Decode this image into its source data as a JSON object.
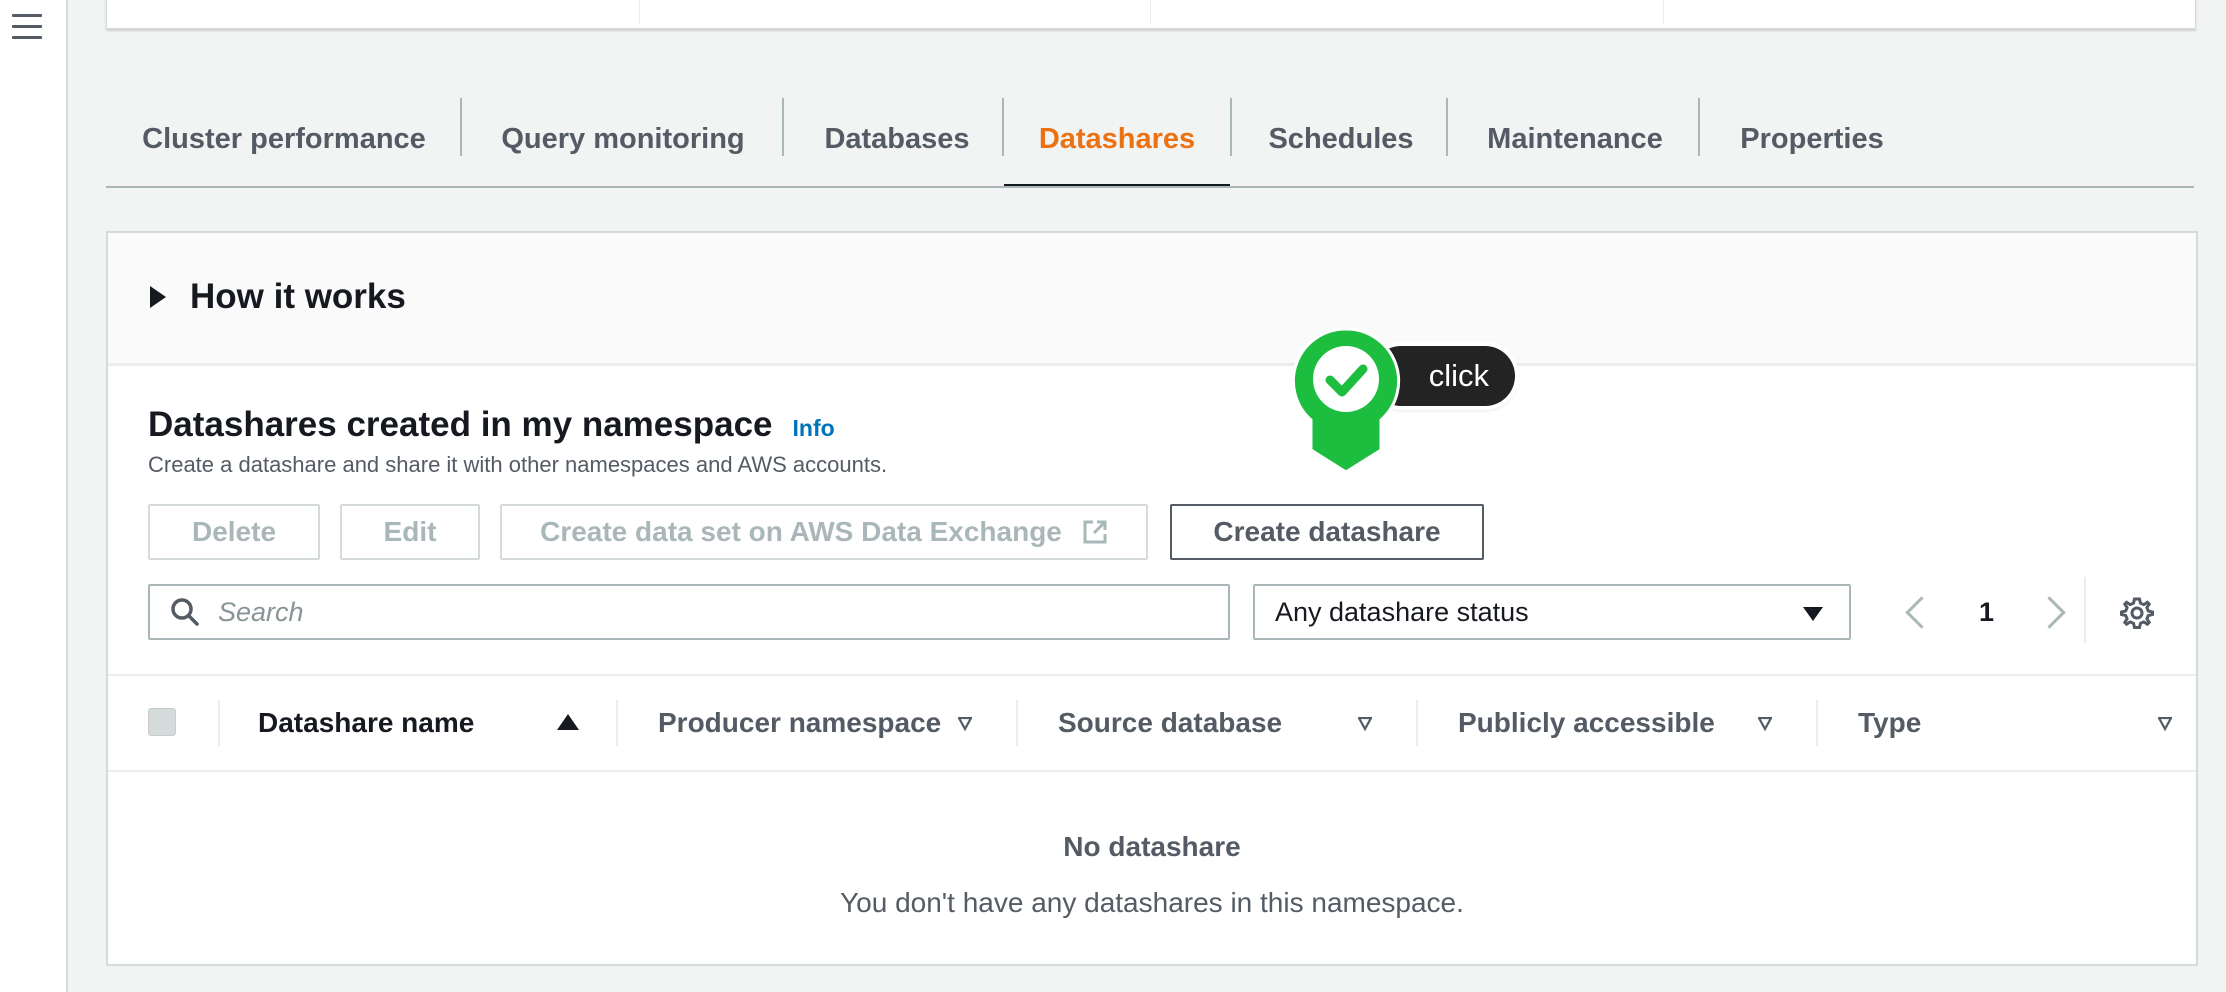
{
  "tabs": [
    {
      "label": "Cluster performance",
      "active": false
    },
    {
      "label": "Query monitoring",
      "active": false
    },
    {
      "label": "Databases",
      "active": false
    },
    {
      "label": "Datashares",
      "active": true
    },
    {
      "label": "Schedules",
      "active": false
    },
    {
      "label": "Maintenance",
      "active": false
    },
    {
      "label": "Properties",
      "active": false
    }
  ],
  "how_it_works": {
    "label": "How it works"
  },
  "section": {
    "title": "Datashares created in my namespace",
    "info_link": "Info",
    "description": "Create a datashare and share it with other namespaces and AWS accounts."
  },
  "actions": {
    "delete": "Delete",
    "edit": "Edit",
    "create_data_set": "Create data set on AWS Data Exchange",
    "create_datashare": "Create datashare"
  },
  "search": {
    "placeholder": "Search",
    "value": ""
  },
  "status_filter": {
    "selected": "Any datashare status"
  },
  "pagination": {
    "current_page": "1"
  },
  "table": {
    "columns": [
      "Datashare name",
      "Producer namespace",
      "Source database",
      "Publicly accessible",
      "Type"
    ],
    "sorted_column": "Datashare name",
    "sort_direction": "ascending",
    "rows": []
  },
  "empty_state": {
    "title": "No datashare",
    "description": "You don't have any datashares in this namespace."
  },
  "annotation": {
    "label": "click"
  },
  "colors": {
    "accent_orange": "#ec7211",
    "link_blue": "#0073bb",
    "callout_green": "#1dbe3f",
    "text_dark": "#16191f",
    "text_muted": "#545b64"
  }
}
